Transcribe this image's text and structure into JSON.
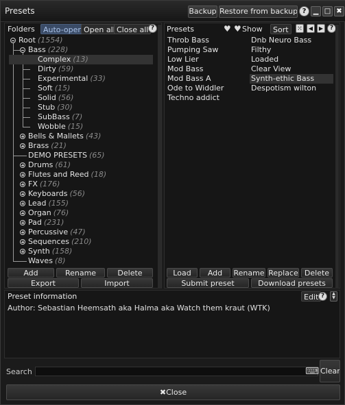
{
  "window": {
    "title": "Presets",
    "backup_label": "Backup",
    "restore_label": "Restore from backup",
    "help_glyph": "?",
    "minimize_glyph": "▁",
    "maximize_glyph": "□",
    "close_glyph": "✖"
  },
  "folders": {
    "header": "Folders",
    "auto_open": "Auto-open",
    "open_all": "Open all",
    "close_all": "Close all",
    "help": "?",
    "tree": [
      {
        "label": "Root",
        "count": "(1554)"
      },
      {
        "label": "Bass",
        "count": "(228)"
      },
      {
        "label": "Complex",
        "count": "(13)"
      },
      {
        "label": "Dirty",
        "count": "(59)"
      },
      {
        "label": "Experimental",
        "count": "(33)"
      },
      {
        "label": "Soft",
        "count": "(15)"
      },
      {
        "label": "Solid",
        "count": "(56)"
      },
      {
        "label": "Stub",
        "count": "(30)"
      },
      {
        "label": "SubBass",
        "count": "(7)"
      },
      {
        "label": "Wobble",
        "count": "(15)"
      },
      {
        "label": "Bells & Mallets",
        "count": "(43)"
      },
      {
        "label": "Brass",
        "count": "(21)"
      },
      {
        "label": "DEMO PRESETS",
        "count": "(65)"
      },
      {
        "label": "Drums",
        "count": "(61)"
      },
      {
        "label": "Flutes and Reed",
        "count": "(18)"
      },
      {
        "label": "FX",
        "count": "(176)"
      },
      {
        "label": "Keyboards",
        "count": "(56)"
      },
      {
        "label": "Lead",
        "count": "(155)"
      },
      {
        "label": "Organ",
        "count": "(76)"
      },
      {
        "label": "Pad",
        "count": "(231)"
      },
      {
        "label": "Percussive",
        "count": "(47)"
      },
      {
        "label": "Sequences",
        "count": "(210)"
      },
      {
        "label": "Synth",
        "count": "(158)"
      },
      {
        "label": "Waves",
        "count": "(8)"
      }
    ],
    "buttons": {
      "add": "Add",
      "rename": "Rename",
      "delete": "Delete",
      "export": "Export",
      "import": "Import"
    }
  },
  "presets": {
    "header": "Presets",
    "show": "Show",
    "sort": "Sort",
    "col1": [
      "Throb Bass",
      "Pumping Saw",
      "Low Lier",
      "Mod Bass",
      "Mod Bass A",
      "Ode to Widdler",
      "Techno addict"
    ],
    "col2": [
      "Dnb Neuro Bass",
      "Filthy",
      "Loaded",
      "Clear View",
      "Synth-ethic Bass",
      "Despotism wilton"
    ],
    "buttons": {
      "load": "Load",
      "add": "Add",
      "rename": "Rename",
      "replace": "Replace",
      "delete": "Delete",
      "submit": "Submit preset",
      "download": "Download presets"
    }
  },
  "info": {
    "header": "Preset information",
    "edit": "Edit",
    "help": "?",
    "text": "Author: Sebastian Heemsath aka Halma aka Watch them kraut (WTK)"
  },
  "search": {
    "label": "Search",
    "value": "",
    "clear": "Clear"
  },
  "footer": {
    "close": "Close"
  }
}
